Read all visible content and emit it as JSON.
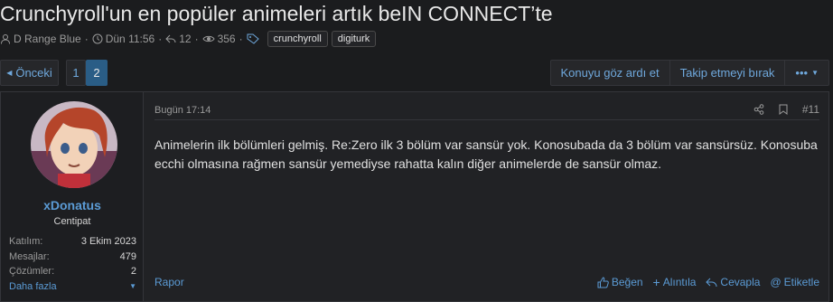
{
  "thread": {
    "title": "Crunchyroll'un en popüler animeleri artık beIN CONNECT’te",
    "author": "D Range Blue",
    "time": "Dün 11:56",
    "replies": "12",
    "views": "356",
    "tags": [
      "crunchyroll",
      "digiturk"
    ]
  },
  "pagination": {
    "prev_label": "Önceki",
    "pages": [
      "1",
      "2"
    ],
    "current": "2"
  },
  "thread_actions": {
    "ignore_label": "Konuyu göz ardı et",
    "unfollow_label": "Takip etmeyi bırak",
    "more_label": "•••"
  },
  "post": {
    "date": "Bugün 17:14",
    "number": "#11",
    "body": "Animelerin ilk bölümleri gelmiş. Re:Zero ilk 3 bölüm var sansür yok. Konosubada da 3 bölüm var sansürsüz. Konosuba ecchi olmasına rağmen sansür yemediyse rahatta kalın diğer animelerde de sansür olmaz.",
    "report_label": "Rapor",
    "like_label": "Beğen",
    "quote_label": "Alıntıla",
    "reply_label": "Cevapla",
    "tag_label": "Etiketle"
  },
  "user": {
    "name": "xDonatus",
    "title": "Centipat",
    "stats": [
      {
        "label": "Katılım:",
        "value": "3 Ekim 2023"
      },
      {
        "label": "Mesajlar:",
        "value": "479"
      },
      {
        "label": "Çözümler:",
        "value": "2"
      }
    ],
    "more_label": "Daha fazla"
  }
}
